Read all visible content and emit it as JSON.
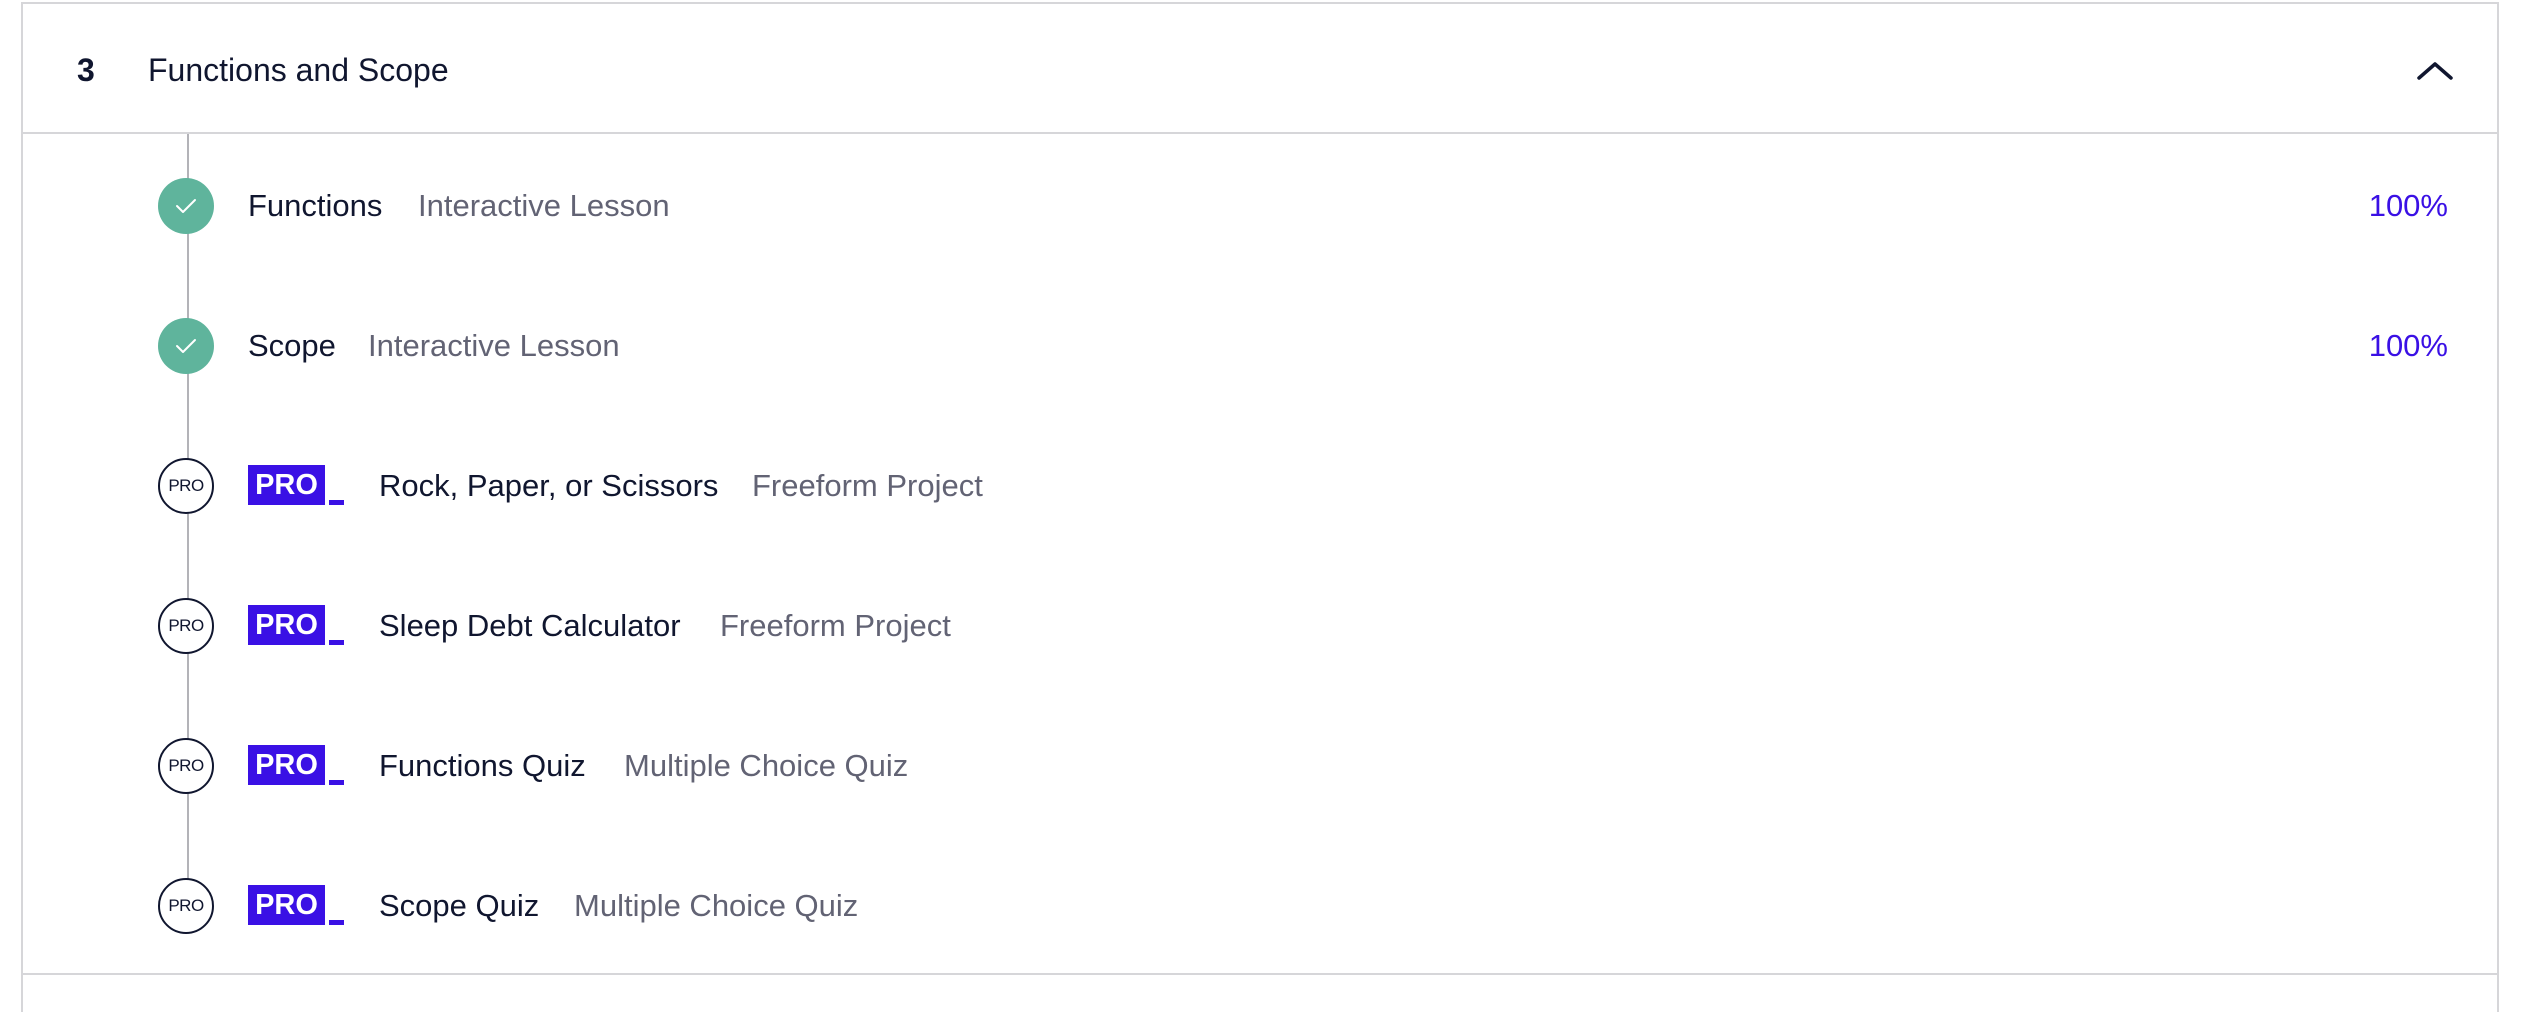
{
  "module": {
    "number": "3",
    "title": "Functions and Scope",
    "chevron_icon": "chevron-up-icon"
  },
  "items": [
    {
      "title": "Functions",
      "type": "Interactive Lesson",
      "status": "complete",
      "progress": "100%"
    },
    {
      "title": "Scope",
      "type": "Interactive Lesson",
      "status": "complete",
      "progress": "100%"
    },
    {
      "title": "Rock, Paper, or Scissors",
      "type": "Freeform Project",
      "status": "locked",
      "pro_badge": "PRO",
      "status_label": "PRO"
    },
    {
      "title": "Sleep Debt Calculator",
      "type": "Freeform Project",
      "status": "locked",
      "pro_badge": "PRO",
      "status_label": "PRO"
    },
    {
      "title": "Functions Quiz",
      "type": "Multiple Choice Quiz",
      "status": "locked",
      "pro_badge": "PRO",
      "status_label": "PRO"
    },
    {
      "title": "Scope Quiz",
      "type": "Multiple Choice Quiz",
      "status": "locked",
      "pro_badge": "PRO",
      "status_label": "PRO"
    }
  ],
  "colors": {
    "complete": "#5fb49c",
    "pro": "#3a10e5",
    "progress_text": "#3a10e5",
    "text": "#10162f",
    "muted_text": "#626374"
  }
}
